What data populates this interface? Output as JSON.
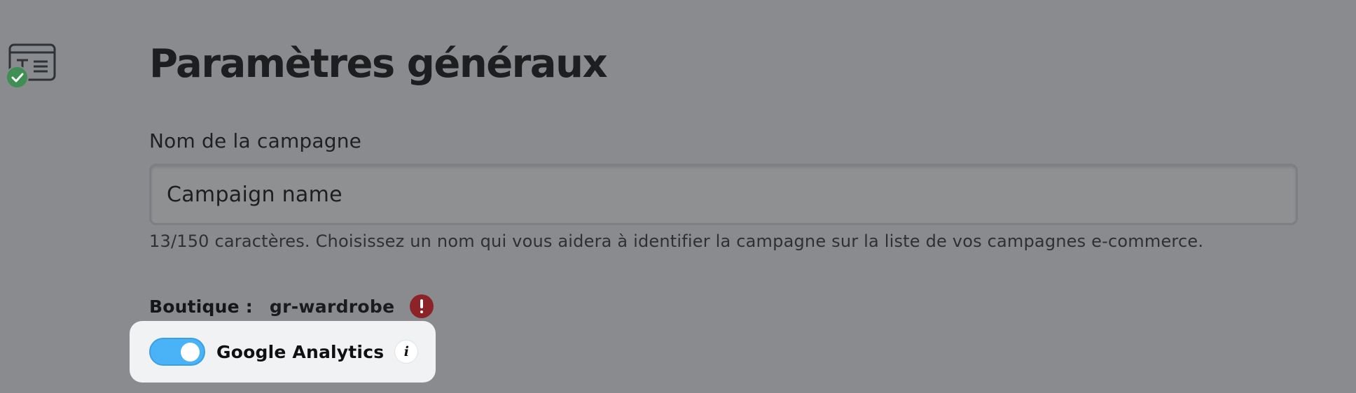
{
  "header": {
    "title": "Paramètres généraux",
    "step_icon": "text-form-icon",
    "status_icon": "check-circle-icon"
  },
  "campaign_name": {
    "label": "Nom de la campagne",
    "value": "Campaign name",
    "help_text": "13/150 caractères. Choisissez un nom qui vous aidera à identifier la campagne sur la liste de vos campagnes e-commerce."
  },
  "store": {
    "label": "Boutique :",
    "value": "gr-wardrobe",
    "alert_icon": "exclamation-circle-icon"
  },
  "google_analytics": {
    "label": "Google Analytics",
    "enabled": true,
    "info_icon": "info-icon"
  },
  "colors": {
    "background_dimmed": "#8a8b8e",
    "toggle_on": "#4ab3f7",
    "success": "#3f8e54",
    "alert": "#8c2328",
    "highlight_card": "#f1f2f4"
  }
}
